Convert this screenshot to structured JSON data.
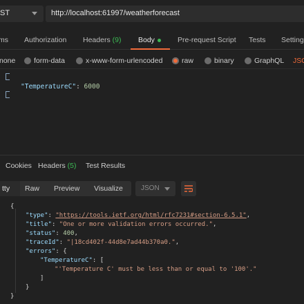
{
  "request": {
    "method": "GET",
    "method_visible": "ST",
    "url": "http://localhost:61997/weatherforecast"
  },
  "request_tabs": [
    {
      "label": "ms",
      "count": ""
    },
    {
      "label": "Authorization",
      "count": ""
    },
    {
      "label": "Headers",
      "count": "(9)"
    },
    {
      "label": "Body",
      "count": "",
      "active": true
    },
    {
      "label": "Pre-request Script",
      "count": ""
    },
    {
      "label": "Tests",
      "count": ""
    },
    {
      "label": "Settings",
      "count": ""
    }
  ],
  "body_types": [
    {
      "label": "none",
      "selected": false
    },
    {
      "label": "form-data",
      "selected": false
    },
    {
      "label": "x-www-form-urlencoded",
      "selected": false
    },
    {
      "label": "raw",
      "selected": true
    },
    {
      "label": "binary",
      "selected": false
    },
    {
      "label": "GraphQL",
      "selected": false
    },
    {
      "label": "JSON",
      "selected": false
    }
  ],
  "request_body": {
    "key": "\"TemperatureC\"",
    "value": "6000"
  },
  "response_tabs": [
    {
      "label": "Cookies",
      "count": ""
    },
    {
      "label": "Headers",
      "count": "(5)"
    },
    {
      "label": "Test Results",
      "count": ""
    }
  ],
  "view_modes": [
    "tty",
    "Raw",
    "Preview",
    "Visualize"
  ],
  "format": "JSON",
  "response": {
    "open_brace": "{",
    "type_key": "\"type\"",
    "type_value": "\"https://tools.ietf.org/html/rfc7231#section-6.5.1\"",
    "title_key": "\"title\"",
    "title_value": "\"One or more validation errors occurred.\"",
    "status_key": "\"status\"",
    "status_value": "400",
    "traceid_key": "\"traceId\"",
    "traceid_value": "\"|18cd402f-44d8e7ad44b370a0.\"",
    "errors_key": "\"errors\"",
    "temp_key": "\"TemperatureC\"",
    "error_message": "\"'Temperature C' must be less than or equal to '100'.\"",
    "close_bracket": "]",
    "close_inner": "}",
    "close_brace": "}"
  },
  "colors": {
    "accent": "#f26b3a",
    "count_green": "#3cba54",
    "json_key": "#9cdcfe",
    "json_string": "#d69d85",
    "json_number": "#b5cea8"
  }
}
